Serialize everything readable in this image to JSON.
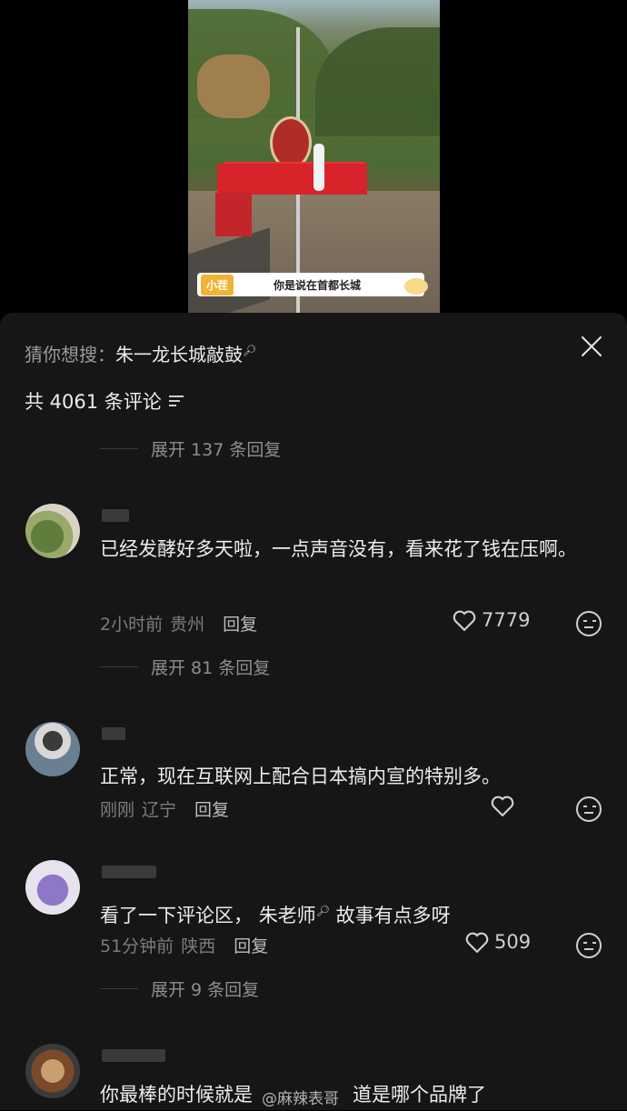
{
  "video": {
    "subtitle_tag": "小茬",
    "subtitle_text": "你是说在首都长城"
  },
  "panel": {
    "search_prefix": "猜你想搜：",
    "search_term": "朱一龙长城敲鼓",
    "comment_count": "共 4061 条评论"
  },
  "threads": [
    {
      "expand_label": "展开 137 条回复"
    }
  ],
  "comments": [
    {
      "text": "已经发酵好多天啦，一点声音没有，看来花了钱在压啊。",
      "time": "2小时前",
      "location": "贵州",
      "reply_label": "回复",
      "likes": "7779",
      "expand_label": "展开 81 条回复"
    },
    {
      "text": "正常，现在互联网上配合日本搞内宣的特别多。",
      "time": "刚刚",
      "location": "辽宁",
      "reply_label": "回复",
      "likes": ""
    },
    {
      "text_a": "看了一下评论区，",
      "text_link": "朱老师",
      "text_b": "故事有点多呀",
      "time": "51分钟前",
      "location": "陕西",
      "reply_label": "回复",
      "likes": "509",
      "expand_label": "展开 9 条回复"
    },
    {
      "text": "你最棒的时候就是",
      "text_tail": "道是哪个品牌了"
    }
  ],
  "watermark": "@麻辣表哥",
  "colors": {
    "panel_bg": "#161616",
    "page_bg": "#000000",
    "text": "#ececec",
    "muted": "#7c7c7c"
  }
}
